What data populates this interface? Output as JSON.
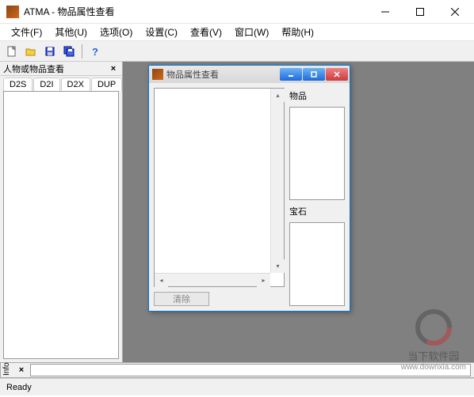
{
  "titlebar": {
    "app_name": "ATMA",
    "separator": " - ",
    "doc_title": "物品属性查看"
  },
  "menus": {
    "file": "文件(F)",
    "other": "其他(U)",
    "options": "选项(O)",
    "settings": "设置(C)",
    "view": "查看(V)",
    "window": "窗口(W)",
    "help": "帮助(H)"
  },
  "side_panel": {
    "title": "人物或物品查看",
    "tabs": {
      "d2s": "D2S",
      "d2i": "D2I",
      "d2x": "D2X",
      "dup": "DUP"
    }
  },
  "child_window": {
    "title": "物品属性查看",
    "labels": {
      "items": "物品",
      "gems": "宝石"
    },
    "clear_btn": "清除"
  },
  "info": {
    "label": "Info"
  },
  "statusbar": {
    "ready": "Ready"
  },
  "watermark": {
    "text": "当下软件园",
    "url": "www.downxia.com"
  }
}
